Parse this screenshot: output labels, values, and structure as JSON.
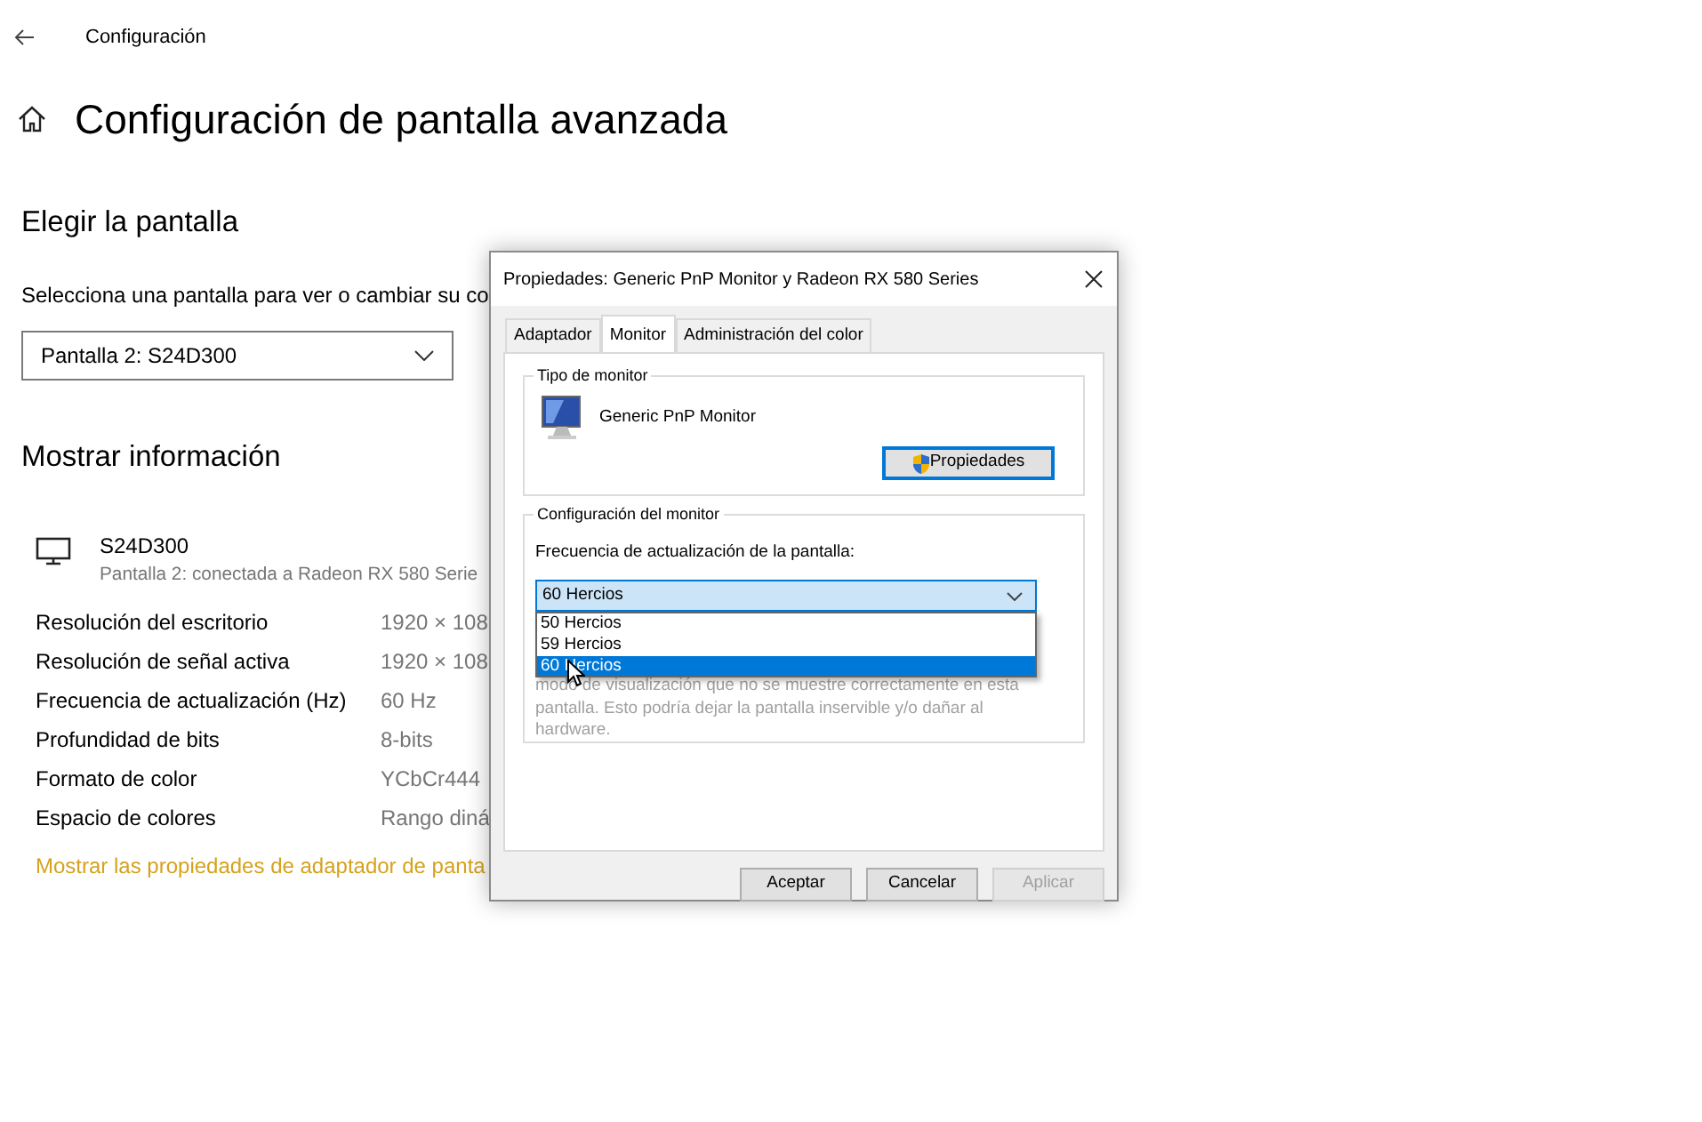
{
  "header": {
    "title": "Configuración"
  },
  "page": {
    "title": "Configuración de pantalla avanzada"
  },
  "choose": {
    "heading": "Elegir la pantalla",
    "description": "Selecciona una pantalla para ver o cambiar su co",
    "display_select": "Pantalla 2: S24D300"
  },
  "info": {
    "heading": "Mostrar información",
    "monitor_name": "S24D300",
    "monitor_detail": "Pantalla 2: conectada a Radeon RX 580 Serie",
    "rows": [
      {
        "label": "Resolución del escritorio",
        "value": "1920 × 108"
      },
      {
        "label": "Resolución de señal activa",
        "value": "1920 × 108"
      },
      {
        "label": "Frecuencia de actualización (Hz)",
        "value": "60 Hz"
      },
      {
        "label": "Profundidad de bits",
        "value": "8-bits"
      },
      {
        "label": "Formato de color",
        "value": "YCbCr444"
      },
      {
        "label": "Espacio de colores",
        "value": "Rango diná"
      }
    ],
    "link": "Mostrar las propiedades de adaptador de panta"
  },
  "dialog": {
    "title": "Propiedades: Generic PnP Monitor y Radeon RX 580 Series",
    "tabs": [
      {
        "label": "Adaptador",
        "selected": false
      },
      {
        "label": "Monitor",
        "selected": true
      },
      {
        "label": "Administración del color",
        "selected": false
      }
    ],
    "monitor_type": {
      "legend": "Tipo de monitor",
      "name": "Generic PnP Monitor",
      "button": "Propiedades"
    },
    "monitor_settings": {
      "legend": "Configuración del monitor",
      "label": "Frecuencia de actualización de la pantalla:",
      "refresh_value": "60 Hercios",
      "options": [
        {
          "label": "50 Hercios",
          "selected": false
        },
        {
          "label": "59 Hercios",
          "selected": false
        },
        {
          "label": "60 Hercios",
          "selected": true
        }
      ],
      "warning": "modo de visualización que no se muestre correctamente en esta pantalla. Esto podría dejar la pantalla inservible y/o dañar al hardware."
    },
    "buttons": [
      {
        "label": "Aceptar",
        "disabled": false
      },
      {
        "label": "Cancelar",
        "disabled": false
      },
      {
        "label": "Aplicar",
        "disabled": true
      }
    ]
  }
}
